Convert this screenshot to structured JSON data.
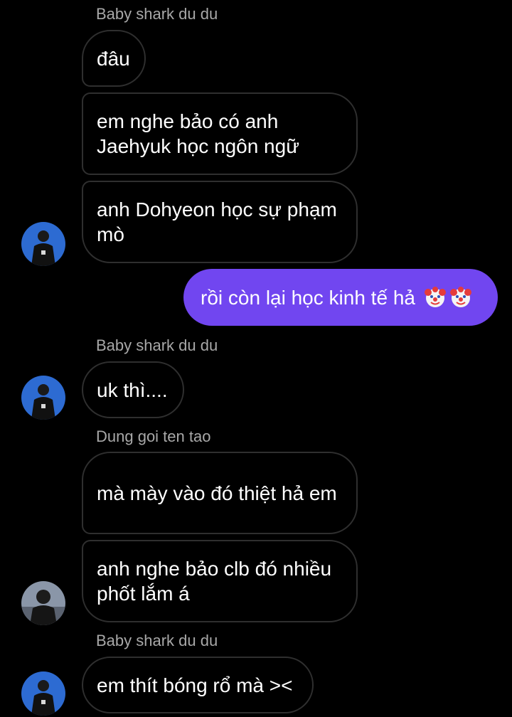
{
  "messages": {
    "group1_sender": "Baby shark du du",
    "m1": "đâu",
    "m2": "em nghe bảo có anh Jaehyuk học ngôn ngữ",
    "m3": "anh Dohyeon học sự phạm mò",
    "m4": "rồi còn lại học kinh tế hả",
    "m4_emoji": [
      "clown-face",
      "clown-face"
    ],
    "group2_sender": "Baby shark du du",
    "m5": "uk thì....",
    "group3_sender": "Dung goi ten tao",
    "m6": "mà mày vào đó thiệt hả em",
    "m7": "anh nghe bảo clb đó nhiều phốt lắm á",
    "group4_sender": "Baby shark du du",
    "m8": "em thít bóng rổ mà ><"
  },
  "colors": {
    "background": "#000000",
    "outgoing_bubble": "#7146f0",
    "incoming_border": "#2f2f2f",
    "sender_name": "#a8a8a8",
    "avatar_blue": "#2d6bd2"
  }
}
